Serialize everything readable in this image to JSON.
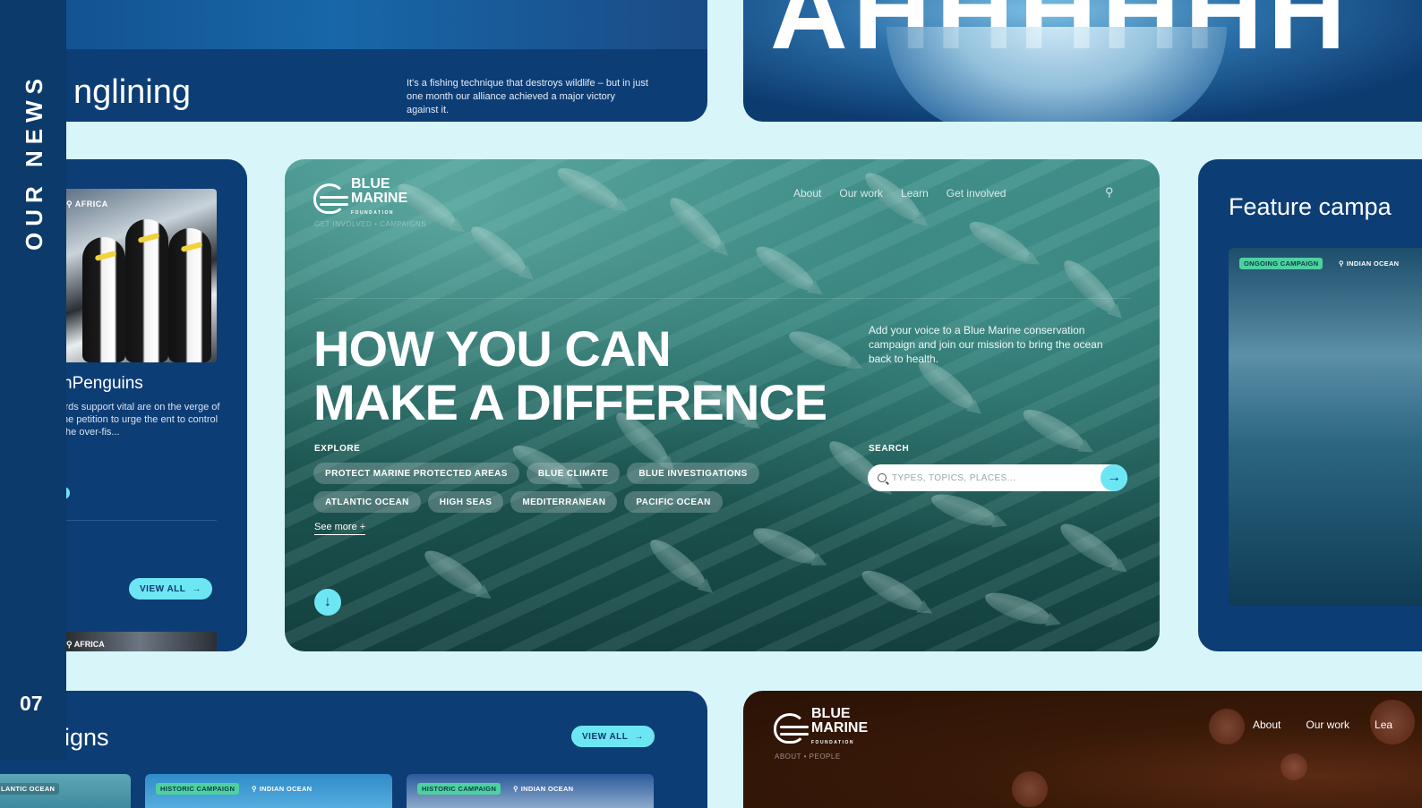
{
  "rail": {
    "title": "OUR NEWS",
    "page_number": "07"
  },
  "top_left_card": {
    "heading": "nglining",
    "description": "It's a fishing technique that destroys wildlife – but in just one month our alliance achieved a major victory against it."
  },
  "top_right_card": {
    "big_text": "AHHHHHH"
  },
  "middle_left_card": {
    "tag": "AFRICA",
    "title": "nPenguins",
    "text": "irds support vital are on the verge of ne petition to urge the ent to control the over-fis...",
    "button_label": "VIEW ALL",
    "second_tag": "AFRICA"
  },
  "hero": {
    "logo": {
      "line1": "BLUE",
      "line2": "MARINE",
      "sub": "FOUNDATION"
    },
    "breadcrumb": "GET INVOLVED  •  CAMPAIGNS",
    "nav": [
      "About",
      "Our work",
      "Learn",
      "Get involved"
    ],
    "headline_line1": "HOW YOU CAN",
    "headline_line2": "MAKE A DIFFERENCE",
    "intro": "Add your voice to a Blue Marine conservation campaign and join our mission to bring the ocean back to health.",
    "explore_label": "EXPLORE",
    "chips": [
      "PROTECT MARINE PROTECTED AREAS",
      "BLUE CLIMATE",
      "BLUE INVESTIGATIONS",
      "ATLANTIC OCEAN",
      "HIGH SEAS",
      "MEDITERRANEAN",
      "PACIFIC OCEAN"
    ],
    "see_more": "See more +",
    "search_label": "SEARCH",
    "search_placeholder": "TYPES, TOPICS, PLACES..."
  },
  "middle_right_card": {
    "title": "Feature campa",
    "badge_status": "ONGOING CAMPAIGN",
    "badge_location": "INDIAN OCEAN"
  },
  "bottom_left_card": {
    "title": "igns",
    "button_label": "VIEW ALL",
    "thumbs": [
      {
        "status": "",
        "location": "LANTIC OCEAN"
      },
      {
        "status": "HISTORIC CAMPAIGN",
        "location": "INDIAN OCEAN"
      },
      {
        "status": "HISTORIC CAMPAIGN",
        "location": "INDIAN OCEAN"
      }
    ]
  },
  "bottom_right_card": {
    "logo": {
      "line1": "BLUE",
      "line2": "MARINE",
      "sub": "FOUNDATION"
    },
    "breadcrumb": "ABOUT  •  PEOPLE",
    "nav": [
      "About",
      "Our work",
      "Lea"
    ]
  },
  "colors": {
    "accent": "#6de6f4",
    "navy": "#0d3d75",
    "background": "#d8f6fa",
    "badge_green": "#4ed1a0"
  },
  "icons": [
    "arrow-right-icon",
    "search-icon",
    "arrow-down-icon",
    "location-pin-icon",
    "logo-wave-icon"
  ]
}
